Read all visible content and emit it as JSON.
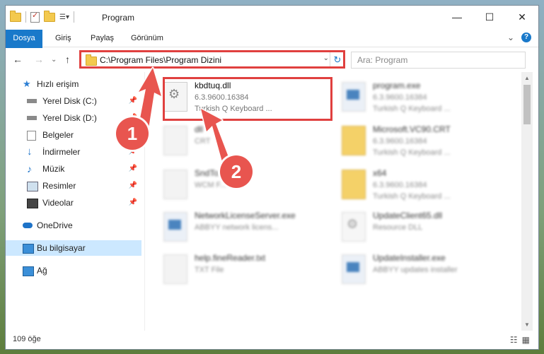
{
  "window": {
    "title": "Program",
    "controls": {
      "minimize": "—",
      "maximize": "☐",
      "close": "✕"
    }
  },
  "ribbon": {
    "tabs": [
      "Dosya",
      "Giriş",
      "Paylaş",
      "Görünüm"
    ],
    "expand_glyph": "⌄",
    "help_glyph": "?"
  },
  "nav": {
    "back_glyph": "←",
    "forward_glyph": "→",
    "recent_glyph": "⌄",
    "up_glyph": "↑",
    "address_value": "C:\\Program Files\\Program Dizini",
    "address_drop_glyph": "⌄",
    "refresh_glyph": "↻",
    "search_placeholder": "Ara: Program"
  },
  "sidebar": {
    "items": [
      {
        "label": "Hızlı erişim",
        "icon": "star-icon",
        "pinned": false
      },
      {
        "label": "Yerel Disk (C:)",
        "icon": "drive-icon",
        "pinned": true
      },
      {
        "label": "Yerel Disk (D:)",
        "icon": "drive-icon",
        "pinned": true
      },
      {
        "label": "Belgeler",
        "icon": "documents-icon",
        "pinned": true
      },
      {
        "label": "İndirmeler",
        "icon": "download-icon",
        "pinned": true
      },
      {
        "label": "Müzik",
        "icon": "music-icon",
        "pinned": true
      },
      {
        "label": "Resimler",
        "icon": "pictures-icon",
        "pinned": true
      },
      {
        "label": "Videolar",
        "icon": "videos-icon",
        "pinned": true
      },
      {
        "label": "OneDrive",
        "icon": "cloud-icon",
        "pinned": false
      },
      {
        "label": "Bu bilgisayar",
        "icon": "computer-icon",
        "pinned": false
      },
      {
        "label": "Ağ",
        "icon": "network-icon",
        "pinned": false
      }
    ],
    "pin_glyph": "📌"
  },
  "files": [
    {
      "name": "kbdtuq.dll",
      "line2": "6.3.9600.16384",
      "line3": "Turkish Q Keyboard ...",
      "type": "dll",
      "highlighted": true
    },
    {
      "name": "program.exe",
      "line2": "6.3.9600.16384",
      "line3": "Turkish Q Keyboard ...",
      "type": "exe",
      "highlighted": false
    },
    {
      "name": "dll",
      "line2": "CRT",
      "line3": "",
      "type": "blank",
      "highlighted": false
    },
    {
      "name": "Microsoft.VC90.CRT",
      "line2": "6.3.9600.16384",
      "line3": "Turkish Q Keyboard ...",
      "type": "folder",
      "highlighted": false
    },
    {
      "name": "SndTo...wcm",
      "line2": "WCM F...",
      "line3": "",
      "type": "blank",
      "highlighted": false
    },
    {
      "name": "x64",
      "line2": "6.3.9600.16384",
      "line3": "Turkish Q Keyboard ...",
      "type": "folder",
      "highlighted": false
    },
    {
      "name": "NetworkLicenseServer.exe",
      "line2": "ABBYY network licens...",
      "line3": "",
      "type": "exe",
      "highlighted": false
    },
    {
      "name": "UpdateClient65.dll",
      "line2": "Resource DLL",
      "line3": "",
      "type": "dll",
      "highlighted": false
    },
    {
      "name": "help.fineReader.txt",
      "line2": "TXT File",
      "line3": "",
      "type": "blank",
      "highlighted": false
    },
    {
      "name": "UpdateInstaller.exe",
      "line2": "ABBYY updates installer",
      "line3": "",
      "type": "exe",
      "highlighted": false
    }
  ],
  "status": {
    "count": "109 öğe",
    "details_view_glyph": "☷",
    "icons_view_glyph": "▦"
  },
  "annotations": {
    "badge_1": "1",
    "badge_2": "2",
    "color": "#e0403f"
  }
}
